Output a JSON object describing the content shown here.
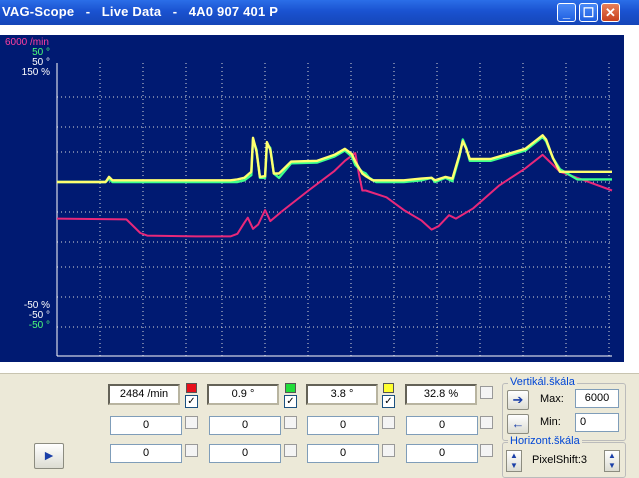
{
  "window": {
    "title": "VAG-Scope   -   Live Data   -   4A0 907 401 P",
    "minimize_glyph": "_",
    "maximize_glyph": "☐",
    "close_glyph": "✕"
  },
  "plot": {
    "background": "#001a72",
    "grid": true,
    "top_labels": [
      {
        "text": "6000 /min",
        "color": "#ff3fa0"
      },
      {
        "text": "50 °",
        "color": "#4cff7a"
      },
      {
        "text": "50 °",
        "color": "#ffffff"
      },
      {
        "text": "150 %",
        "color": "#ffffff"
      }
    ],
    "bottom_labels": [
      {
        "text": "-50 %",
        "color": "#ffffff"
      },
      {
        "text": "-50 °",
        "color": "#ffffff"
      },
      {
        "text": "-50 °",
        "color": "#4cff7a"
      }
    ]
  },
  "chart_data": {
    "type": "line",
    "series": [
      {
        "color": "#e8287a",
        "values": [
          [
            0,
            -0.43
          ],
          [
            40,
            -0.44
          ],
          [
            48,
            -0.6
          ],
          [
            52,
            -0.63
          ],
          [
            80,
            -0.64
          ],
          [
            100,
            -0.64
          ],
          [
            104,
            -0.61
          ],
          [
            108,
            -0.48
          ],
          [
            110,
            -0.42
          ],
          [
            113,
            -0.55
          ],
          [
            116,
            -0.5
          ],
          [
            120,
            -0.33
          ],
          [
            123,
            -0.46
          ],
          [
            130,
            -0.34
          ],
          [
            145,
            -0.1
          ],
          [
            160,
            0.13
          ],
          [
            166,
            0.25
          ],
          [
            172,
            0.34
          ],
          [
            174,
            0.1
          ],
          [
            176,
            -0.1
          ],
          [
            178,
            -0.1
          ],
          [
            190,
            -0.18
          ],
          [
            200,
            -0.33
          ],
          [
            210,
            -0.45
          ],
          [
            216,
            -0.56
          ],
          [
            220,
            -0.52
          ],
          [
            226,
            -0.39
          ],
          [
            230,
            -0.43
          ],
          [
            240,
            -0.31
          ],
          [
            255,
            -0.04
          ],
          [
            270,
            0.16
          ],
          [
            280,
            0.32
          ],
          [
            283,
            0.26
          ],
          [
            290,
            0.12
          ],
          [
            300,
            0.05
          ],
          [
            320,
            -0.1
          ]
        ]
      },
      {
        "color": "#3fff8c",
        "values": [
          [
            0,
            0.0
          ],
          [
            28,
            0.0
          ],
          [
            30,
            0.04
          ],
          [
            32,
            0.0
          ],
          [
            100,
            0.0
          ],
          [
            104,
            0.0
          ],
          [
            108,
            0.02
          ],
          [
            112,
            0.08
          ],
          [
            113,
            0.5
          ],
          [
            115,
            0.38
          ],
          [
            117,
            0.05
          ],
          [
            120,
            0.05
          ],
          [
            121,
            0.45
          ],
          [
            123,
            0.4
          ],
          [
            125,
            0.1
          ],
          [
            128,
            0.05
          ],
          [
            135,
            0.22
          ],
          [
            150,
            0.23
          ],
          [
            160,
            0.3
          ],
          [
            166,
            0.37
          ],
          [
            170,
            0.3
          ],
          [
            172,
            0.2
          ],
          [
            176,
            0.12
          ],
          [
            178,
            0.1
          ],
          [
            180,
            0.05
          ],
          [
            184,
            0.0
          ],
          [
            200,
            0.0
          ],
          [
            210,
            0.02
          ],
          [
            216,
            0.05
          ],
          [
            218,
            0.0
          ],
          [
            224,
            0.05
          ],
          [
            228,
            0.01
          ],
          [
            232,
            0.3
          ],
          [
            234,
            0.5
          ],
          [
            236,
            0.4
          ],
          [
            238,
            0.25
          ],
          [
            250,
            0.25
          ],
          [
            270,
            0.37
          ],
          [
            280,
            0.53
          ],
          [
            282,
            0.48
          ],
          [
            286,
            0.28
          ],
          [
            290,
            0.15
          ],
          [
            300,
            0.03
          ],
          [
            320,
            0.03
          ]
        ]
      },
      {
        "color": "#ffff70",
        "values": [
          [
            0,
            0.0
          ],
          [
            28,
            0.0
          ],
          [
            30,
            0.06
          ],
          [
            32,
            0.02
          ],
          [
            100,
            0.02
          ],
          [
            104,
            0.03
          ],
          [
            108,
            0.05
          ],
          [
            112,
            0.12
          ],
          [
            113,
            0.52
          ],
          [
            115,
            0.36
          ],
          [
            117,
            0.06
          ],
          [
            120,
            0.07
          ],
          [
            121,
            0.47
          ],
          [
            123,
            0.38
          ],
          [
            125,
            0.1
          ],
          [
            128,
            0.1
          ],
          [
            135,
            0.24
          ],
          [
            150,
            0.25
          ],
          [
            160,
            0.32
          ],
          [
            166,
            0.39
          ],
          [
            170,
            0.33
          ],
          [
            172,
            0.24
          ],
          [
            176,
            0.1
          ],
          [
            178,
            0.07
          ],
          [
            182,
            0.02
          ],
          [
            200,
            0.02
          ],
          [
            210,
            0.04
          ],
          [
            216,
            0.05
          ],
          [
            218,
            0.02
          ],
          [
            224,
            0.06
          ],
          [
            228,
            0.04
          ],
          [
            232,
            0.32
          ],
          [
            234,
            0.48
          ],
          [
            236,
            0.39
          ],
          [
            238,
            0.27
          ],
          [
            250,
            0.27
          ],
          [
            270,
            0.39
          ],
          [
            280,
            0.55
          ],
          [
            282,
            0.5
          ],
          [
            286,
            0.28
          ],
          [
            290,
            0.12
          ],
          [
            300,
            0.12
          ],
          [
            320,
            0.12
          ]
        ]
      }
    ],
    "grid": true,
    "legend": "none"
  },
  "panel": {
    "row1": [
      {
        "value": "2484 /min",
        "swatch": "#e8101c",
        "checked": "✓"
      },
      {
        "value": "0.9 °",
        "swatch": "#22dd3a",
        "checked": "✓"
      },
      {
        "value": "3.8 °",
        "swatch": "#ffff30",
        "checked": "✓"
      },
      {
        "value": "32.8 %",
        "swatch": "",
        "checked": ""
      }
    ],
    "row2": [
      "0",
      "0",
      "0",
      "0"
    ],
    "row3": [
      "0",
      "0",
      "0",
      "0"
    ],
    "vertical_scale": {
      "title": "Vertikál.škála",
      "max_label": "Max:",
      "max_value": "6000",
      "min_label": "Min:",
      "min_value": "0"
    },
    "horizontal_scale": {
      "title": "Horizont.škála",
      "value": "PixelShift:3"
    },
    "play_glyph": "►"
  }
}
